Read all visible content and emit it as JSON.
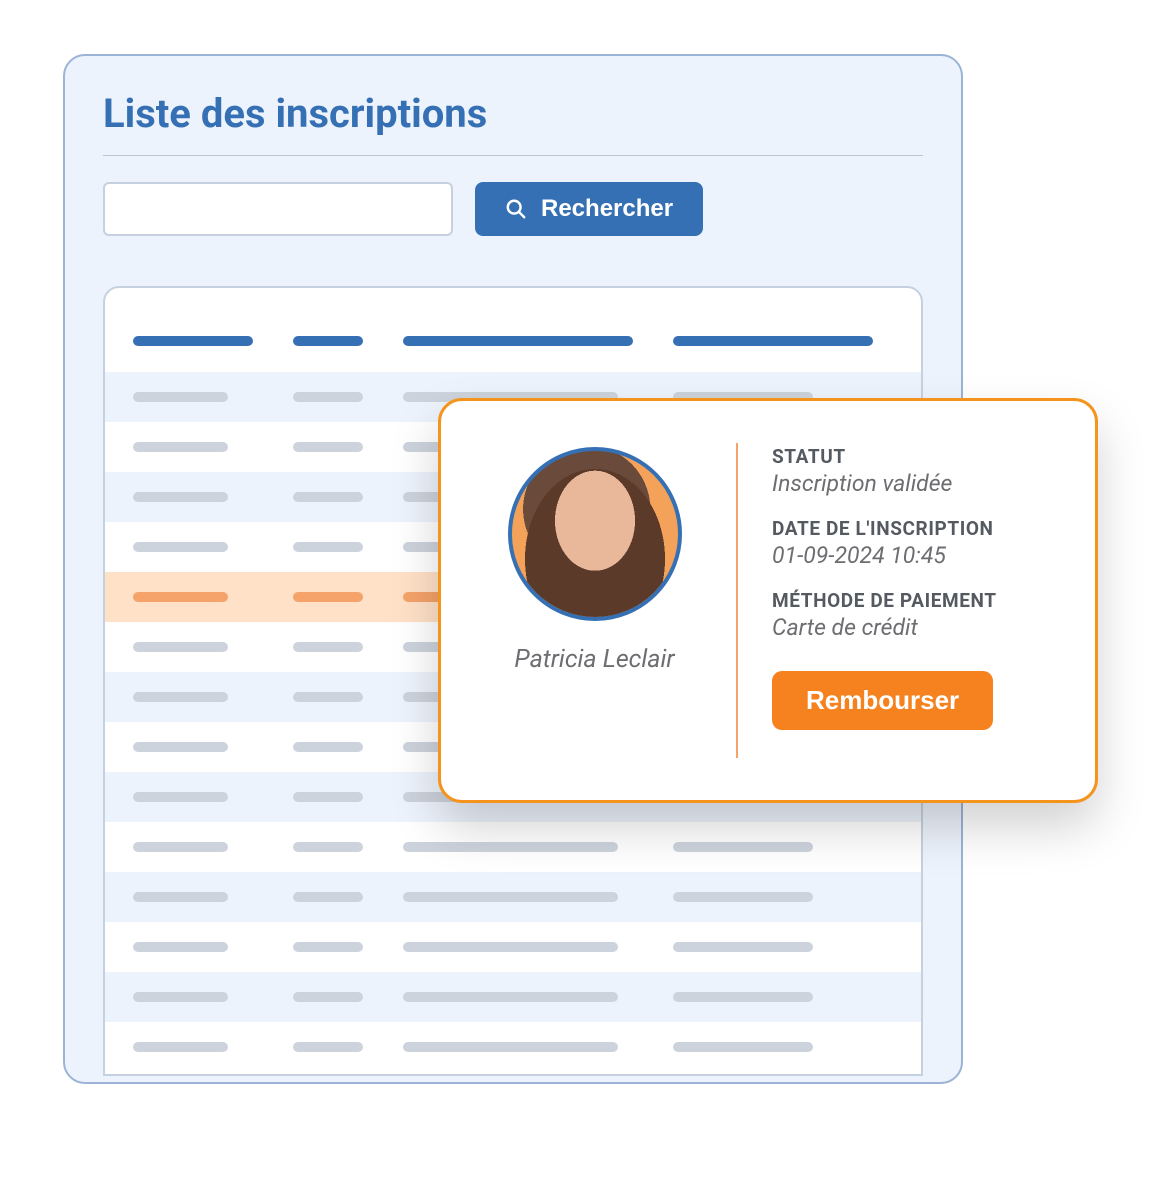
{
  "header": {
    "title": "Liste des inscriptions"
  },
  "search": {
    "value": "",
    "button_label": "Rechercher"
  },
  "detail": {
    "person_name": "Patricia Leclair",
    "status_label": "STATUT",
    "status_value": "Inscription validée",
    "date_label": "DATE DE L'INSCRIPTION",
    "date_value": "01-09-2024 10:45",
    "method_label": "MÉTHODE DE PAIEMENT",
    "method_value": "Carte de crédit",
    "refund_label": "Rembourser"
  },
  "colors": {
    "primary": "#3670b4",
    "accent": "#f5821f",
    "panel_bg": "#edf3fc"
  }
}
